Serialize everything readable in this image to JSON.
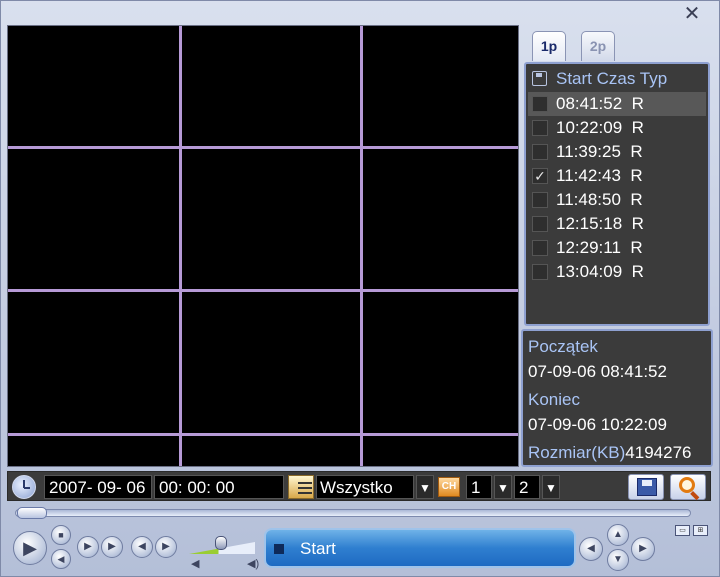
{
  "window": {
    "close_glyph": "✕"
  },
  "tabs": [
    {
      "label": "1p",
      "active": true
    },
    {
      "label": "2p",
      "active": false
    }
  ],
  "file_list": {
    "header": "Start Czas Typ",
    "header_icon": "disk-icon",
    "rows": [
      {
        "time": "08:41:52",
        "type": "R",
        "checked": false,
        "selected": true
      },
      {
        "time": "10:22:09",
        "type": "R",
        "checked": false,
        "selected": false
      },
      {
        "time": "11:39:25",
        "type": "R",
        "checked": false,
        "selected": false
      },
      {
        "time": "11:42:43",
        "type": "R",
        "checked": true,
        "selected": false
      },
      {
        "time": "11:48:50",
        "type": "R",
        "checked": false,
        "selected": false
      },
      {
        "time": "12:15:18",
        "type": "R",
        "checked": false,
        "selected": false
      },
      {
        "time": "12:29:11",
        "type": "R",
        "checked": false,
        "selected": false
      },
      {
        "time": "13:04:09",
        "type": "R",
        "checked": false,
        "selected": false
      }
    ]
  },
  "info": {
    "start_label": "Początek",
    "start_value": "07-09-06 08:41:52",
    "end_label": "Koniec",
    "end_value": "07-09-06 10:22:09",
    "size_label": "Rozmiar(KB)",
    "size_value": "4194276"
  },
  "toolbar": {
    "date": "2007- 09- 06",
    "time": "00: 00: 00",
    "record_type": "Wszystko",
    "channel_icon_text": "CH",
    "channel": "1",
    "channel2": "2",
    "dropdown_glyph": "▼"
  },
  "playback": {
    "status_text": "Start",
    "volume_level": 0.45
  },
  "colors": {
    "grid_lines": "#b69ad6",
    "panel_bg": "#3b3b3b",
    "label_blue": "#a9c4f5",
    "status_blue": "#2f7fd0"
  }
}
